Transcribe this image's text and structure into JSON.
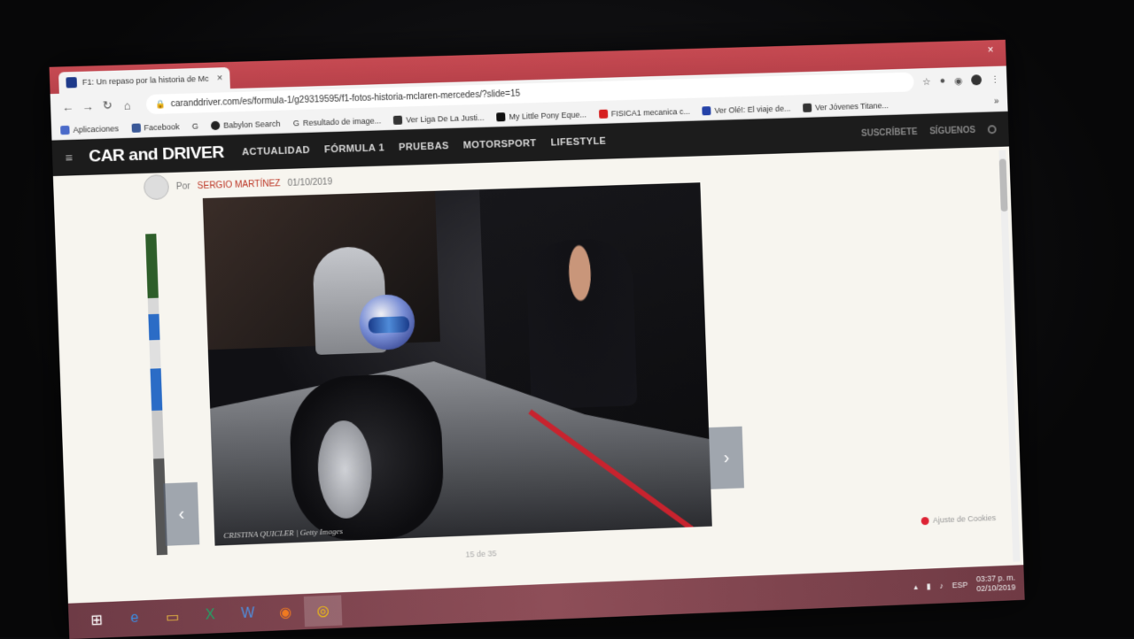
{
  "browser": {
    "tab_title": "F1: Un repaso por la historia de Mc",
    "tab_close": "×",
    "window_close": "×",
    "url": "caranddriver.com/es/formula-1/g29319595/f1-fotos-historia-mclaren-mercedes/?slide=15",
    "nav": {
      "back": "←",
      "forward": "→",
      "reload": "↻",
      "home": "⌂"
    },
    "bookmarks": [
      {
        "label": "Aplicaciones",
        "color": "#4a6ac9"
      },
      {
        "label": "Facebook",
        "color": "#3b5998"
      },
      {
        "label": "G",
        "color": "#ffffff"
      },
      {
        "label": "Babylon Search",
        "color": "#222222"
      },
      {
        "label": "Resultado de image...",
        "color": "#ffffff"
      },
      {
        "label": "Ver Liga De La Justi...",
        "color": "#333333"
      },
      {
        "label": "My Little Pony Eque...",
        "color": "#111111"
      },
      {
        "label": "FISICA1 mecanica c...",
        "color": "#d62020"
      },
      {
        "label": "Ver Olé!: El viaje de...",
        "color": "#2442a8"
      },
      {
        "label": "Ver Jóvenes Titane...",
        "color": "#333333"
      }
    ],
    "bookmarks_more": "»"
  },
  "site": {
    "logo": "CAR and DRIVER",
    "menu_icon": "≡",
    "nav": [
      "ACTUALIDAD",
      "FÓRMULA 1",
      "PRUEBAS",
      "MOTORSPORT",
      "LIFESTYLE"
    ],
    "subscribe": "SUSCRÍBETE",
    "follow": "SÍGUENOS"
  },
  "article": {
    "byline_prefix": "Por",
    "author": "SERGIO MARTÍNEZ",
    "date": "01/10/2019",
    "photo_caption": "CRISTINA QUICLER | Getty Images",
    "slide_counter": "15 de 35",
    "prev_arrow": "‹",
    "next_arrow": "›",
    "cookie_label": "Ajuste de Cookies"
  },
  "taskbar": {
    "start_icon": "⊞",
    "apps": [
      "e",
      "▭",
      "X",
      "W",
      "◉",
      "◎"
    ],
    "lang": "ESP",
    "time": "03:37 p. m.",
    "date": "02/10/2019"
  }
}
